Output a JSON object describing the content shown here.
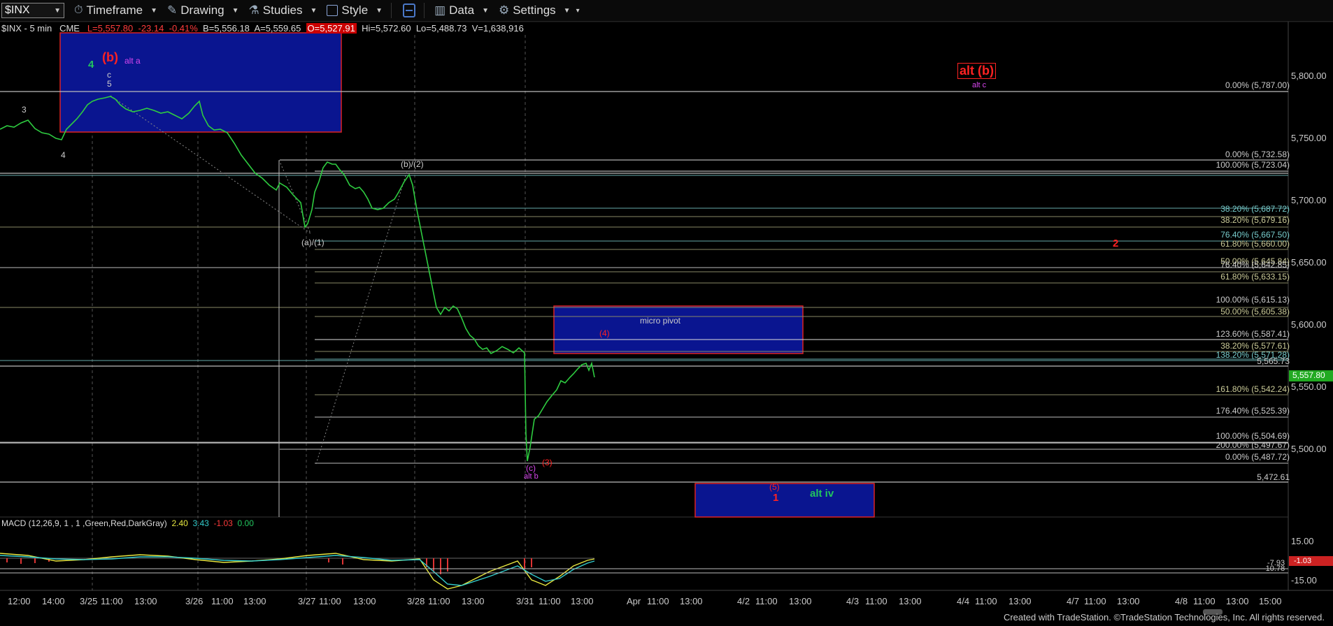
{
  "toolbar": {
    "symbol": "$INX",
    "timeframe": "Timeframe",
    "drawing": "Drawing",
    "studies": "Studies",
    "style": "Style",
    "data": "Data",
    "settings": "Settings"
  },
  "header": {
    "symbol": "$INX - 5 min",
    "exchange": "CME",
    "last": "L=5,557.80",
    "change": "-23.14",
    "pct": "-0.41%",
    "bid": "B=5,556.18",
    "ask": "A=5,559.65",
    "open_hl": "O=5,527.91",
    "hi": "Hi=5,572.60",
    "lo": "Lo=5,488.73",
    "vol": "V=1,638,916"
  },
  "price_axis": [
    "5,800.00",
    "5,750.00",
    "5,700.00",
    "5,650.00",
    "5,600.00",
    "5,550.00",
    "5,500.00"
  ],
  "last_price": "5,557.80",
  "macd": {
    "label": "MACD (12,26,9, 1 , 1 ,Green,Red,DarkGray)",
    "v1": "2.40",
    "v2": "3.43",
    "v3": "-1.03",
    "v4": "0.00",
    "axis": [
      "15.00",
      "-15.00"
    ],
    "readouts": [
      "-7.93",
      "-10.78"
    ],
    "last": "-1.03"
  },
  "time_axis": [
    "12:00",
    "14:00",
    "3/25",
    "11:00",
    "13:00",
    "3/26",
    "11:00",
    "13:00",
    "3/27",
    "11:00",
    "13:00",
    "3/28",
    "11:00",
    "13:00",
    "3/31",
    "11:00",
    "13:00",
    "Apr",
    "11:00",
    "13:00",
    "4/2",
    "11:00",
    "13:00",
    "4/3",
    "11:00",
    "13:00",
    "4/4",
    "11:00",
    "13:00",
    "4/7",
    "11:00",
    "13:00",
    "4/8",
    "11:00",
    "13:00",
    "15:00"
  ],
  "fib_labels": [
    "0.00% (5,787.00)",
    "0.00% (5,732.58)",
    "100.00% (5,723.04)",
    "38.20% (5,687.72)",
    "38.20% (5,679.16)",
    "76.40% (5,667.50)",
    "61.80% (5,660.00)",
    "50.00% (5,645.84)",
    "76.40% (5,642.85)",
    "61.80% (5,633.15)",
    "100.00% (5,615.13)",
    "50.00% (5,605.38)",
    "123.60% (5,587.41)",
    "38.20% (5,577.61)",
    "138.20% (5,571.28)",
    "5,565.73",
    "161.80% (5,542.24)",
    "176.40% (5,525.39)",
    "100.00% (5,504.69)",
    "200.00% (5,497.67)",
    "0.00% (5,487.72)",
    "5,472.61"
  ],
  "annotations": {
    "wave4_green": "4",
    "wave_b_red": "(b)",
    "alt_a": "alt a",
    "c_label": "c",
    "five_label": "5",
    "three": "3",
    "four_low": "4",
    "a1": "(a)/(1)",
    "b2": "(b)/(2)",
    "alt_b_top": "alt (b)",
    "alt_c": "alt c",
    "micro_pivot": "micro pivot",
    "four_red": "(4)",
    "c_low": "(c)",
    "three_red": "(3)",
    "alt_b": "alt b",
    "five_red": "(5)",
    "one_red": "1",
    "alt_iv": "alt iv",
    "two_red": "2"
  },
  "colors": {
    "bullish": "#22c55e",
    "box": "#0a1a8c",
    "red": "#ff2222",
    "magenta": "#d946ef"
  },
  "footer": "Created with TradeStation. ©TradeStation Technologies, Inc. All rights reserved."
}
